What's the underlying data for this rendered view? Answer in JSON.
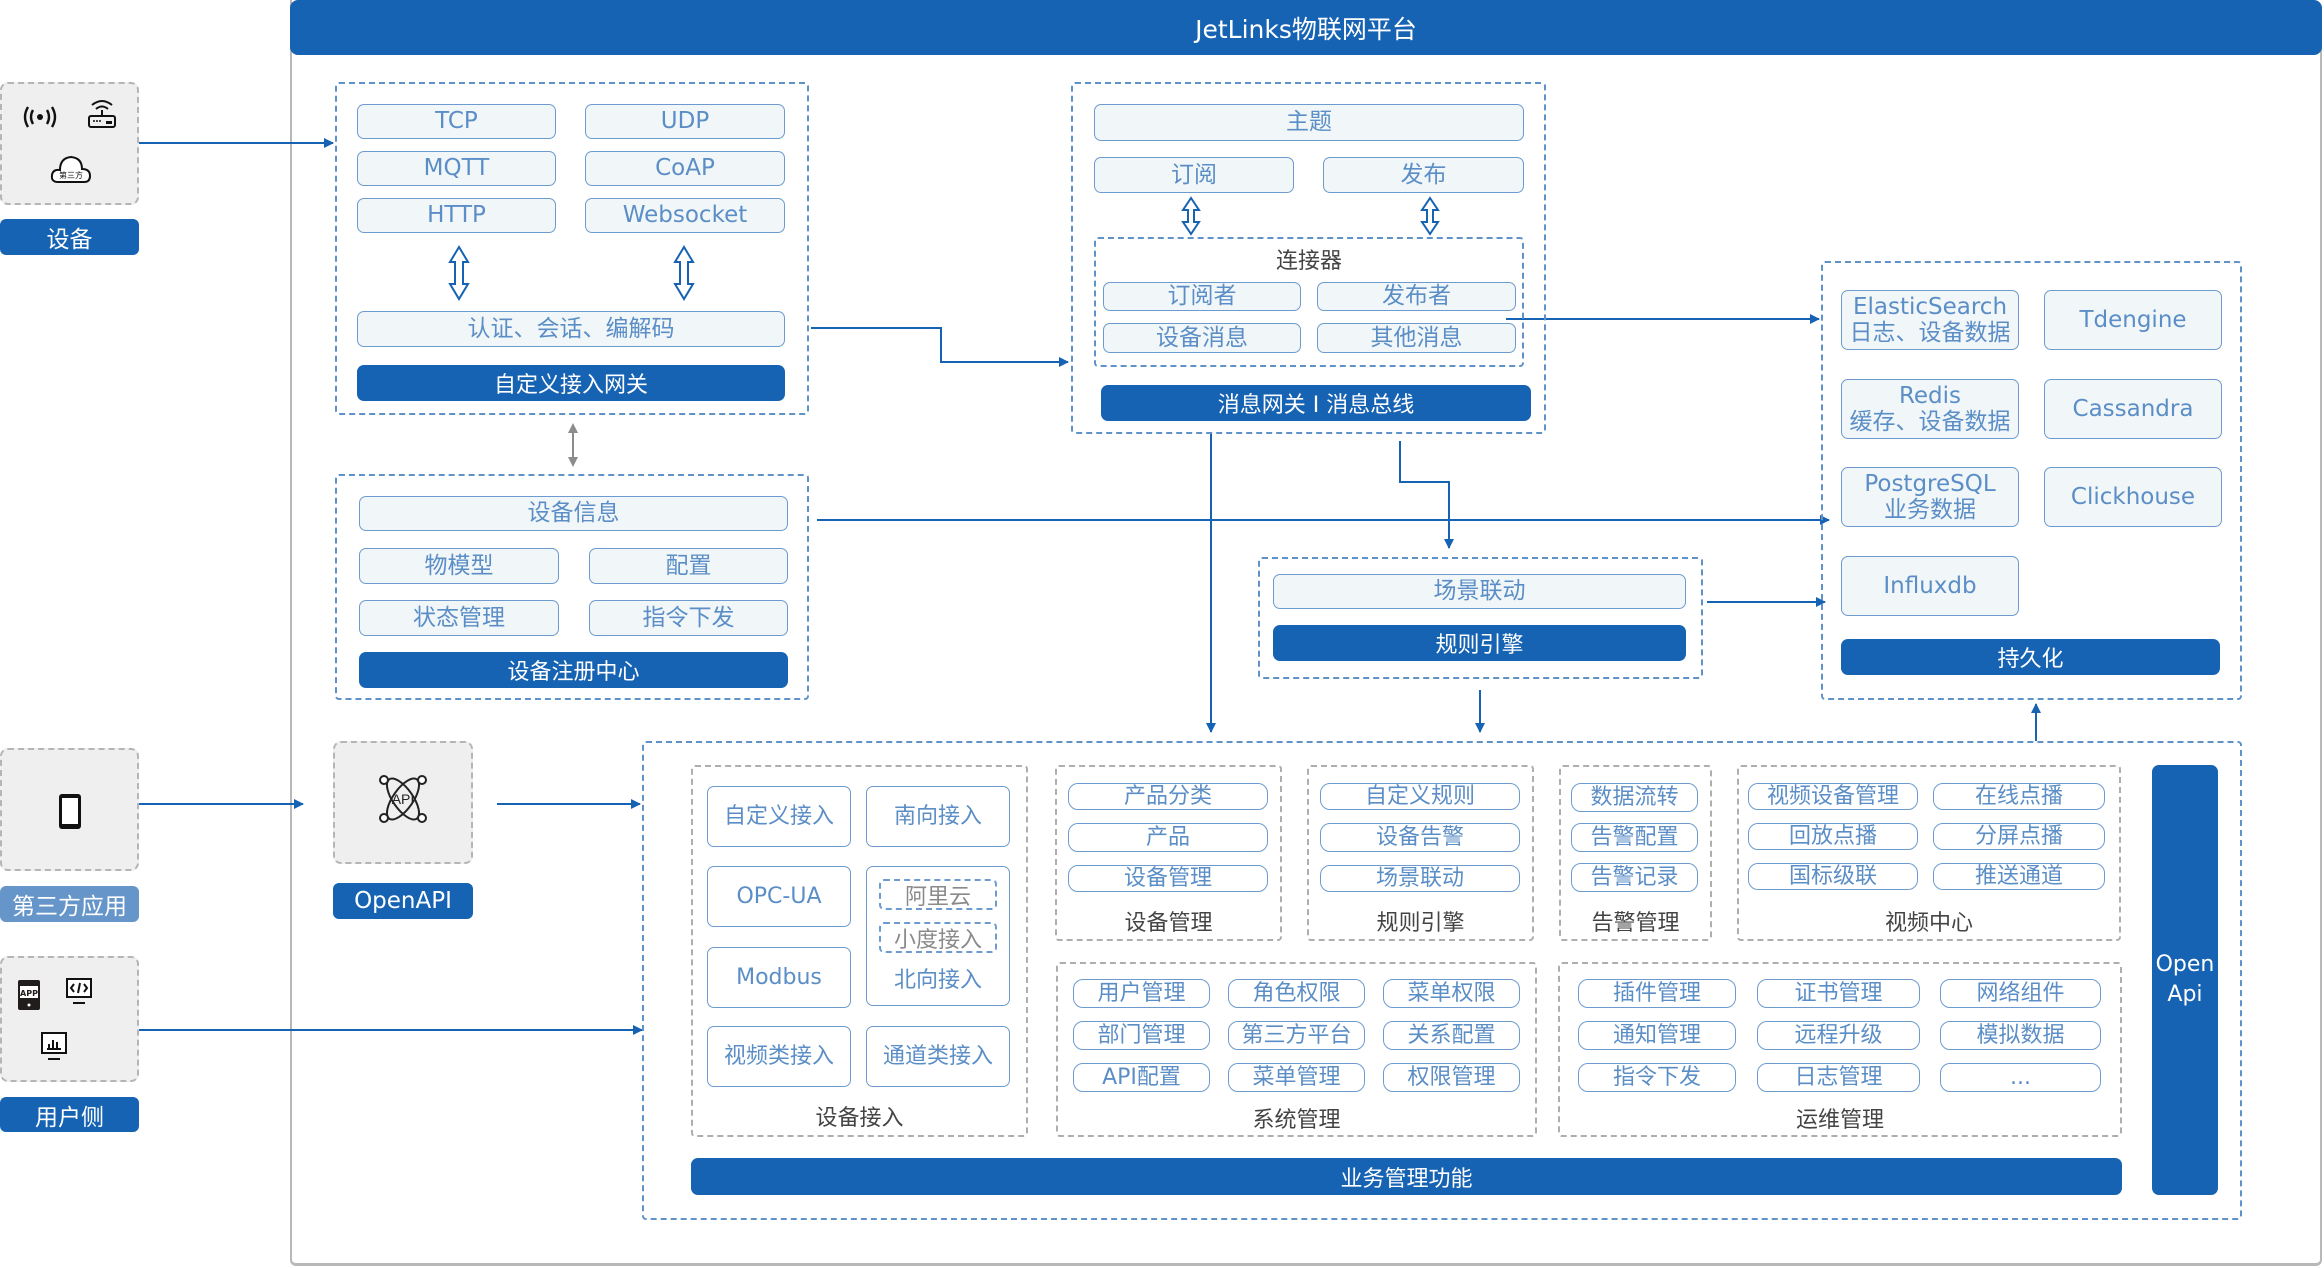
{
  "platform": {
    "title": "JetLinks物联网平台"
  },
  "colors": {
    "primary": "#1763b3",
    "light_label": "#6595c9",
    "pill_text": "#5b8ec6",
    "pill_bg": "#f1f6f8",
    "dash_blue": "#5e92c8",
    "dash_grey": "#aeaeae"
  },
  "external": {
    "devices": {
      "label": "设备",
      "icons": [
        "signal-wave-icon",
        "router-icon",
        "cloud-third-party-icon"
      ],
      "cloud_text": "第三方"
    },
    "third_party": {
      "label": "第三方应用",
      "icons": [
        "smartphone-icon"
      ]
    },
    "user_side": {
      "label": "用户侧",
      "icons": [
        "app-icon",
        "code-monitor-icon",
        "chart-monitor-icon"
      ],
      "app_text": "APP"
    },
    "openapi": {
      "label": "OpenAPI",
      "icon": "api-atom-icon",
      "icon_text": "API"
    }
  },
  "gateway": {
    "title": "自定义接入网关",
    "protocols": [
      "TCP",
      "UDP",
      "MQTT",
      "CoAP",
      "HTTP",
      "Websocket"
    ],
    "codec": "认证、会话、编解码"
  },
  "registry": {
    "title": "设备注册中心",
    "info": "设备信息",
    "items": [
      "物模型",
      "配置",
      "状态管理",
      "指令下发"
    ]
  },
  "message_bus": {
    "title": "消息网关 I 消息总线",
    "topic": "主题",
    "subscribe": "订阅",
    "publish": "发布",
    "connector": {
      "title": "连接器",
      "items": [
        "订阅者",
        "发布者",
        "设备消息",
        "其他消息"
      ]
    }
  },
  "rule_engine": {
    "title": "规则引擎",
    "item": "场景联动"
  },
  "persistence": {
    "title": "持久化",
    "stores": [
      {
        "name": "ElasticSearch",
        "desc": "日志、设备数据"
      },
      {
        "name": "Tdengine",
        "desc": ""
      },
      {
        "name": "Redis",
        "desc": "缓存、设备数据"
      },
      {
        "name": "Cassandra",
        "desc": ""
      },
      {
        "name": "PostgreSQL",
        "desc": "业务数据"
      },
      {
        "name": "Clickhouse",
        "desc": ""
      },
      {
        "name": "Influxdb",
        "desc": ""
      }
    ]
  },
  "business": {
    "title": "业务管理功能",
    "open_api": [
      "Open",
      "Api"
    ],
    "device_access": {
      "title": "设备接入",
      "items": [
        "自定义接入",
        "南向接入",
        "OPC-UA",
        "Modbus",
        "视频类接入",
        "通道类接入"
      ],
      "northbound": {
        "label": "北向接入",
        "sub": [
          "阿里云",
          "小度接入"
        ]
      }
    },
    "device_mgmt": {
      "title": "设备管理",
      "items": [
        "产品分类",
        "产品",
        "设备管理"
      ]
    },
    "rule_engine": {
      "title": "规则引擎",
      "items": [
        "自定义规则",
        "设备告警",
        "场景联动"
      ]
    },
    "alarm_mgmt": {
      "title": "告警管理",
      "items": [
        "数据流转",
        "告警配置",
        "告警记录"
      ]
    },
    "video_center": {
      "title": "视频中心",
      "items": [
        "视频设备管理",
        "在线点播",
        "回放点播",
        "分屏点播",
        "国标级联",
        "推送通道"
      ]
    },
    "system_mgmt": {
      "title": "系统管理",
      "items": [
        "用户管理",
        "角色权限",
        "菜单权限",
        "部门管理",
        "第三方平台",
        "关系配置",
        "API配置",
        "菜单管理",
        "权限管理"
      ]
    },
    "ops_mgmt": {
      "title": "运维管理",
      "items": [
        "插件管理",
        "证书管理",
        "网络组件",
        "通知管理",
        "远程升级",
        "模拟数据",
        "指令下发",
        "日志管理",
        "..."
      ]
    }
  }
}
